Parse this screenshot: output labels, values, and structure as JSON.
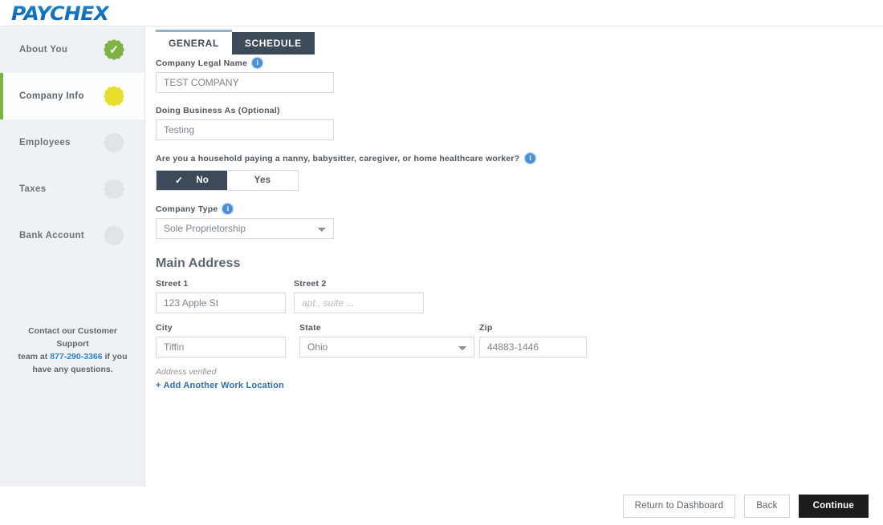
{
  "header": {
    "logo_text": "PAYCHEX"
  },
  "sidebar": {
    "items": [
      {
        "label": "About You",
        "status": "complete",
        "icon": "check-circle-icon"
      },
      {
        "label": "Company Info",
        "status": "current",
        "icon": "current-circle-icon"
      },
      {
        "label": "Employees",
        "status": "pending",
        "icon": "pending-circle-icon"
      },
      {
        "label": "Taxes",
        "status": "pending",
        "icon": "pending-circle-icon"
      },
      {
        "label": "Bank Account",
        "status": "pending",
        "icon": "pending-circle-icon"
      }
    ],
    "support": {
      "line1": "Contact our Customer Support",
      "line2_prefix": "team at ",
      "phone": "877-290-3366",
      "line2_suffix": " if you",
      "line3": "have any questions."
    }
  },
  "tabs": [
    {
      "label": "GENERAL",
      "active": true
    },
    {
      "label": "SCHEDULE",
      "active": false
    }
  ],
  "form": {
    "company_legal_name": {
      "label": "Company Legal Name",
      "value": "TEST COMPANY",
      "info_glyph": "i"
    },
    "doing_business_as": {
      "label": "Doing Business As (Optional)",
      "value": "Testing"
    },
    "household_question": {
      "label": "Are you a household paying a nanny, babysitter, caregiver, or home healthcare worker?",
      "info_glyph": "i",
      "option_no": "No",
      "option_yes": "Yes",
      "selected": "No",
      "check_glyph": "✓"
    },
    "company_type": {
      "label": "Company Type",
      "info_glyph": "i",
      "value": "Sole Proprietorship",
      "options": [
        "Sole Proprietorship"
      ]
    }
  },
  "address": {
    "section_title": "Main Address",
    "street1": {
      "label": "Street 1",
      "value": "123 Apple St"
    },
    "street2": {
      "label": "Street 2",
      "value": "",
      "placeholder": "apt., suite ..."
    },
    "city": {
      "label": "City",
      "value": "Tiffin"
    },
    "state": {
      "label": "State",
      "value": "Ohio",
      "options": [
        "Ohio"
      ]
    },
    "zip": {
      "label": "Zip",
      "value": "44883-1446"
    },
    "verified_text": "Address verified",
    "add_location_link": "+ Add Another Work Location"
  },
  "footer": {
    "return_label": "Return to Dashboard",
    "back_label": "Back",
    "continue_label": "Continue"
  },
  "colors": {
    "brand_blue": "#0b6fc4",
    "complete_green": "#7cb342",
    "current_yellow": "#e8de2a",
    "pending_gray": "#dfe4e8",
    "dark_tab": "#3d4a5a",
    "info_blue": "#4a90d9",
    "link_blue": "#2f6fb0",
    "primary_button": "#1c1c1c"
  }
}
